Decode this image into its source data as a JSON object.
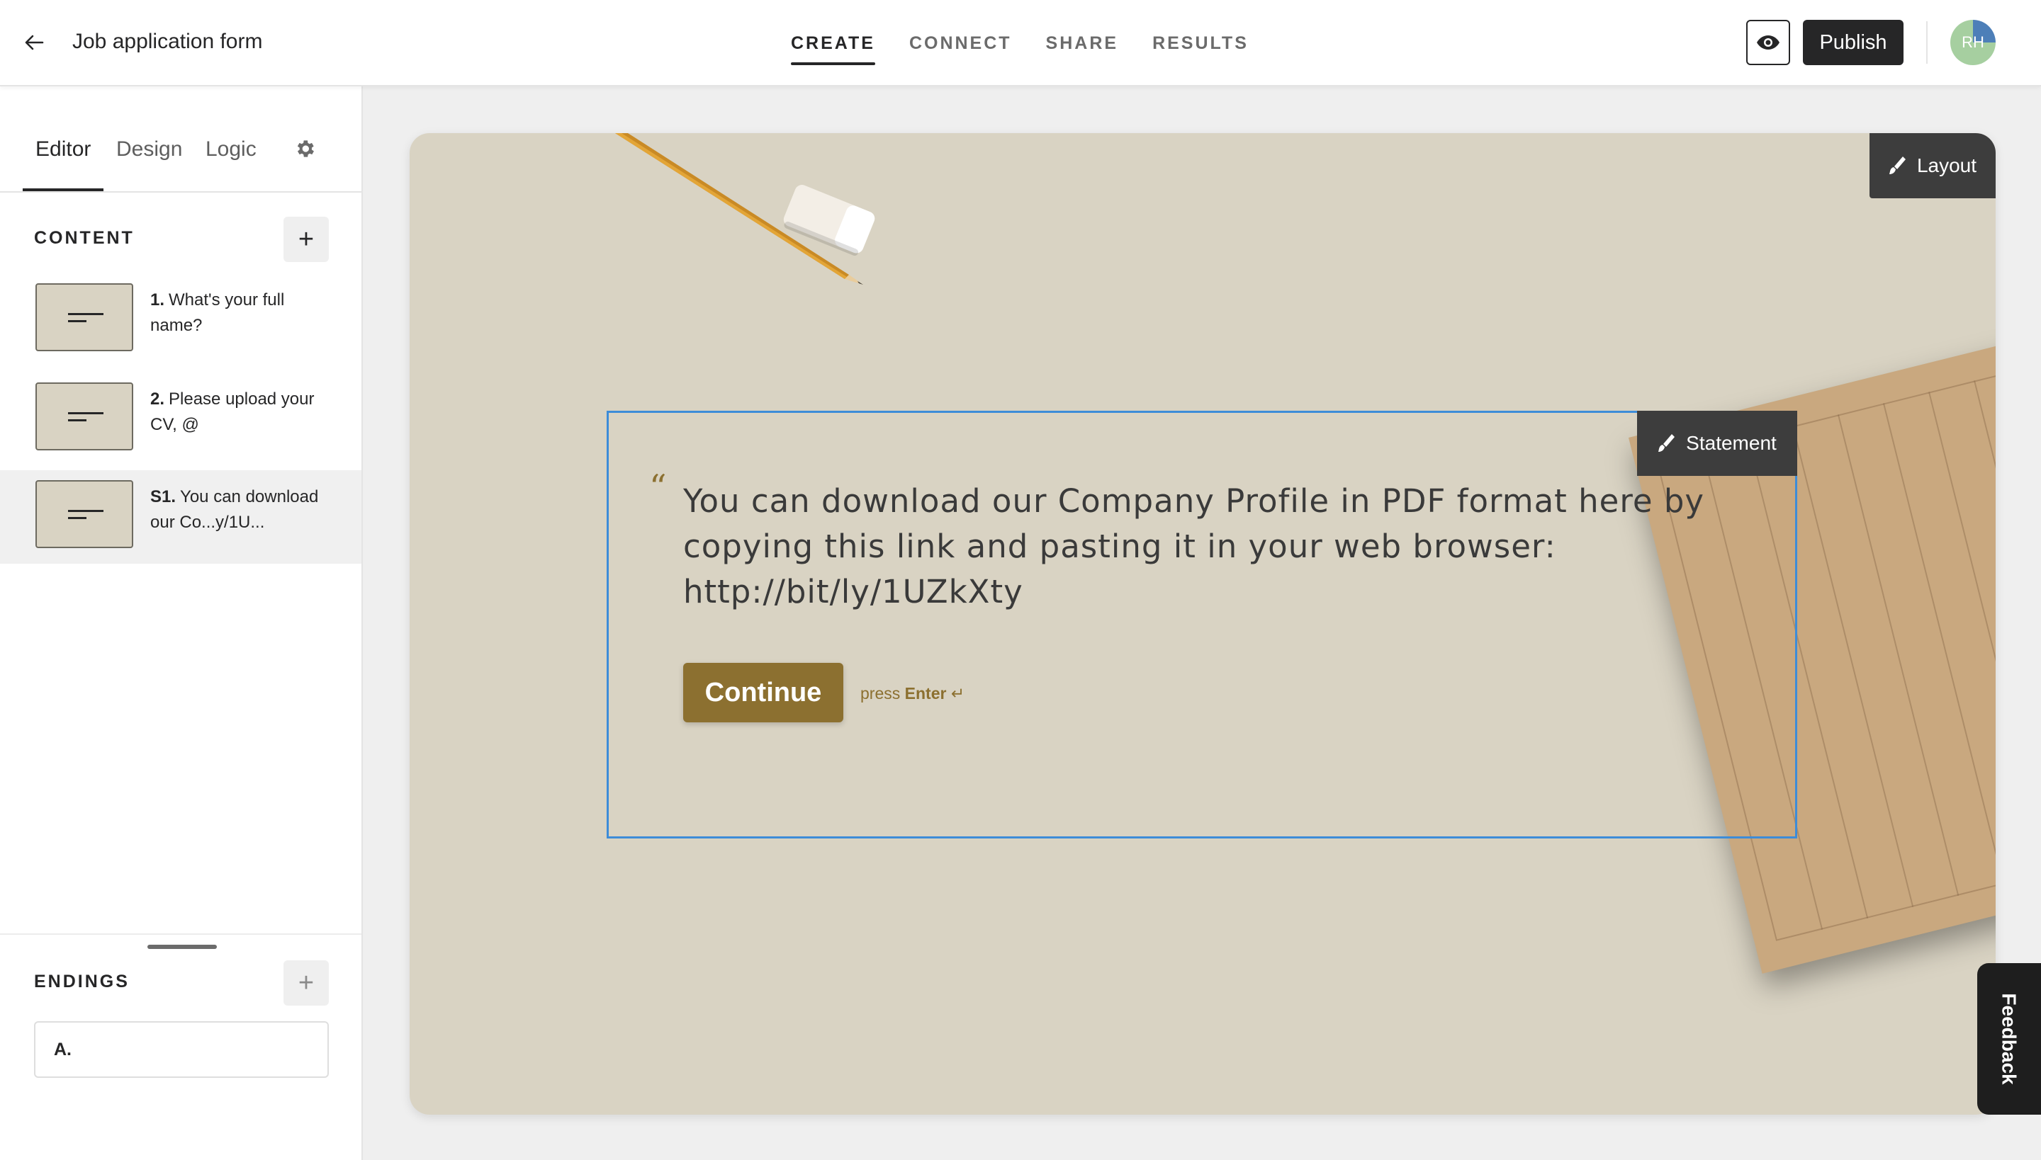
{
  "header": {
    "title": "Job application form",
    "nav": [
      {
        "label": "CREATE",
        "active": true
      },
      {
        "label": "CONNECT",
        "active": false
      },
      {
        "label": "SHARE",
        "active": false
      },
      {
        "label": "RESULTS",
        "active": false
      }
    ],
    "publish_label": "Publish",
    "avatar_initials": "RH"
  },
  "sidebar": {
    "tabs": [
      {
        "label": "Editor",
        "active": true
      },
      {
        "label": "Design",
        "active": false
      },
      {
        "label": "Logic",
        "active": false
      }
    ],
    "content_heading": "CONTENT",
    "content_items": [
      {
        "number": "1.",
        "text": "What's your full name?",
        "selected": false
      },
      {
        "number": "2.",
        "text": "Please upload your CV, @",
        "selected": false
      },
      {
        "number": "S1.",
        "text": "You can download our Co...y/1U...",
        "selected": true
      }
    ],
    "endings_heading": "ENDINGS",
    "endings": [
      {
        "label": "A."
      }
    ]
  },
  "canvas": {
    "layout_label": "Layout",
    "statement_tag": "Statement",
    "quote_mark": "“",
    "statement_text": "You can download our Company Profile in PDF format here by copying this link and pasting it in your web browser: http://bit/ly/1UZkXty",
    "continue_label": "Continue",
    "press_label": "press",
    "enter_label": "Enter",
    "enter_symbol": "↵",
    "background_color": "#d9d3c3",
    "accent_color": "#8c7030",
    "selection_color": "#3d8cd8"
  },
  "feedback_label": "Feedback"
}
